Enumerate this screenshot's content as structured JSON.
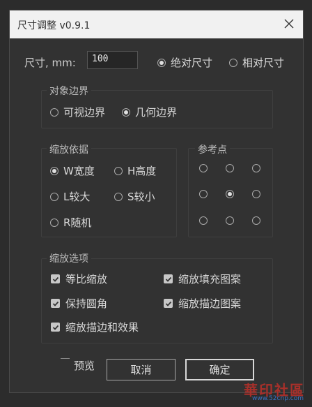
{
  "dialog": {
    "title": "尺寸调整 v0.9.1",
    "size_label": "尺寸, mm:",
    "size_value": "100",
    "mode": [
      {
        "label": "绝对尺寸",
        "checked": true
      },
      {
        "label": "相对尺寸",
        "checked": false
      }
    ],
    "bounds": {
      "title": "对象边界",
      "options": [
        {
          "label": "可视边界",
          "checked": false
        },
        {
          "label": "几何边界",
          "checked": true
        }
      ]
    },
    "scale_basis": {
      "title": "缩放依据",
      "options": [
        {
          "label": "W宽度",
          "checked": true
        },
        {
          "label": "H高度",
          "checked": false
        },
        {
          "label": "L较大",
          "checked": false
        },
        {
          "label": "S较小",
          "checked": false
        },
        {
          "label": "R随机",
          "checked": false
        }
      ]
    },
    "reference_point": {
      "title": "参考点",
      "selected_index": 4,
      "points": 9
    },
    "scale_options": {
      "title": "缩放选项",
      "items": [
        {
          "label": "等比缩放",
          "checked": true
        },
        {
          "label": "缩放填充图案",
          "checked": true
        },
        {
          "label": "保持圆角",
          "checked": true
        },
        {
          "label": "缩放描边图案",
          "checked": true
        },
        {
          "label": "缩放描边和效果",
          "checked": true
        }
      ]
    },
    "preview_label": "预览",
    "cancel_label": "取消",
    "ok_label": "确定"
  },
  "watermark": {
    "brand": "華印社區",
    "url": "www.52cnp.com"
  },
  "colors": {
    "background": "#323232",
    "titlebar": "#f1f1f1",
    "text": "#d8d8d8"
  }
}
